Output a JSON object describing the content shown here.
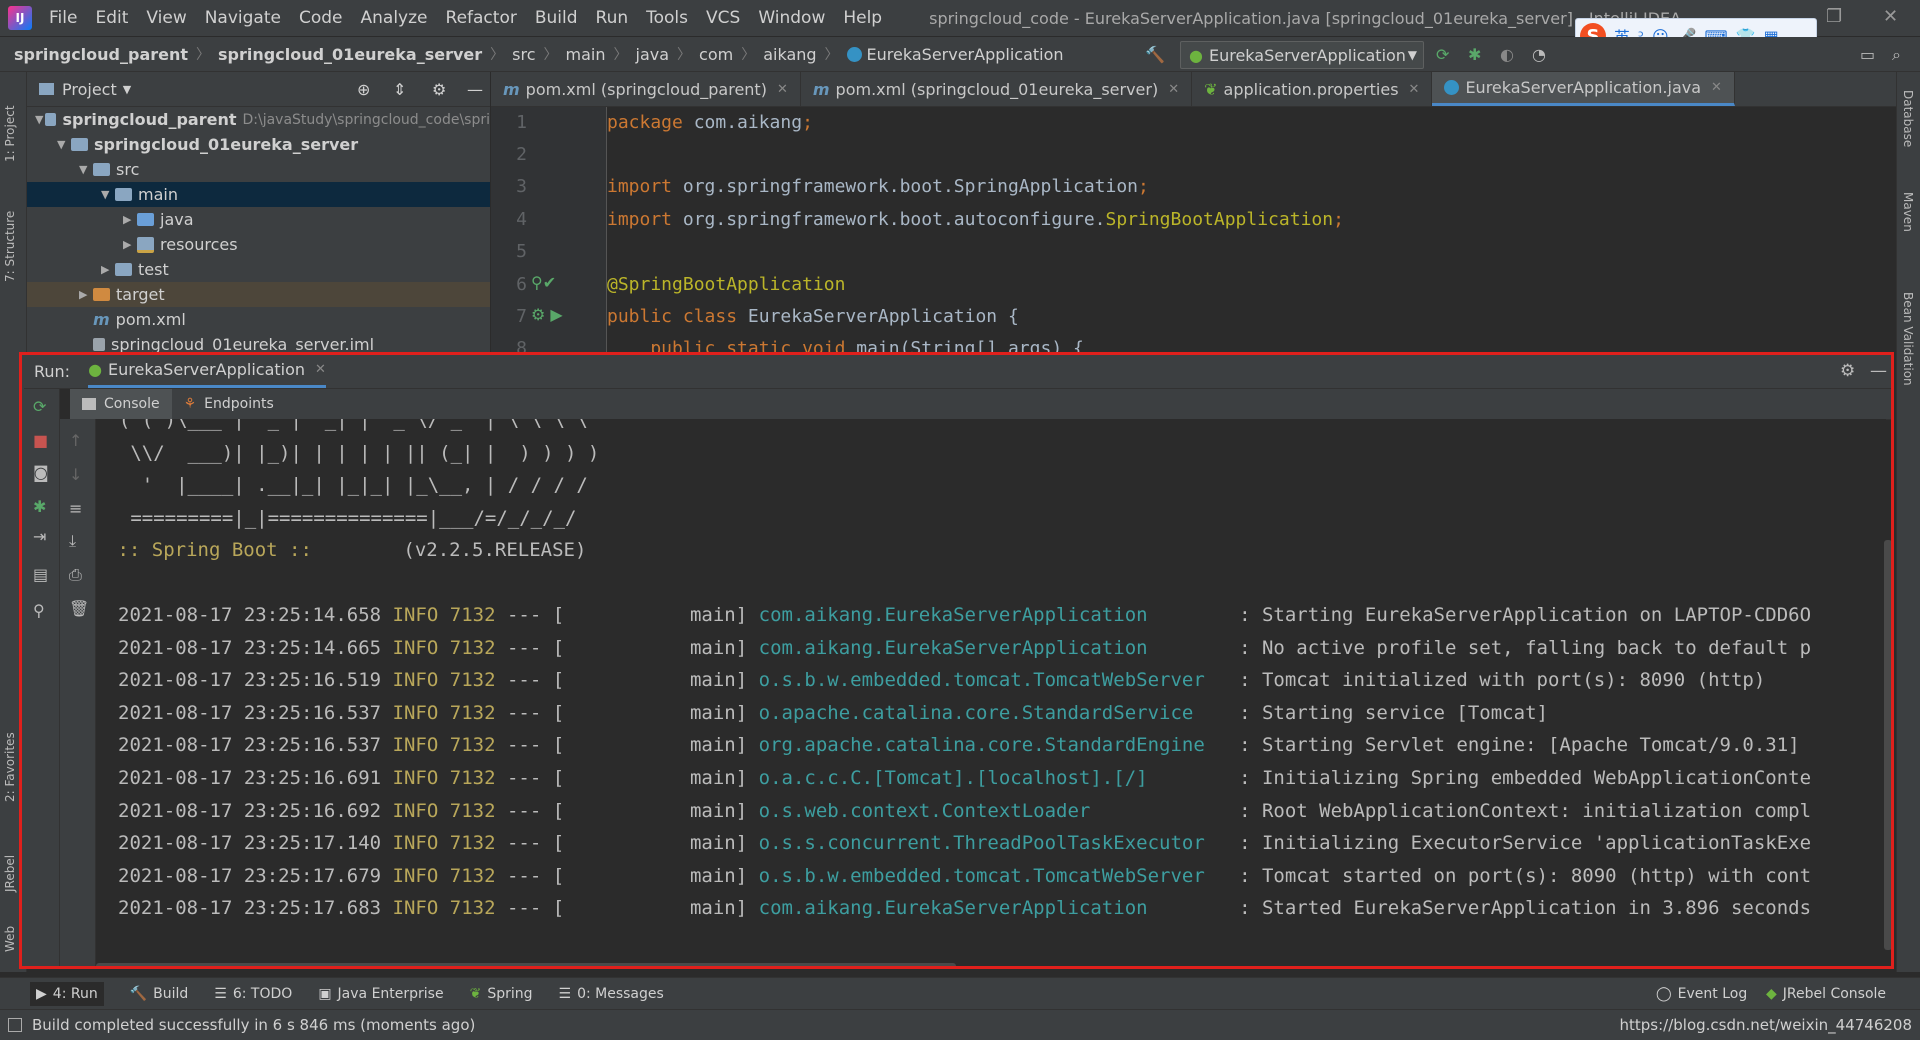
{
  "menubar": {
    "logo": "IJ",
    "items": [
      "File",
      "Edit",
      "View",
      "Navigate",
      "Code",
      "Analyze",
      "Refactor",
      "Build",
      "Run",
      "Tools",
      "VCS",
      "Window",
      "Help"
    ],
    "window_title": "springcloud_code - EurekaServerApplication.java [springcloud_01eureka_server] - IntelliJ IDEA"
  },
  "ime": {
    "logo": "S",
    "mode": "英",
    "punct": "ᵓ"
  },
  "navbar": {
    "breadcrumbs": [
      "springcloud_parent",
      "springcloud_01eureka_server",
      "src",
      "main",
      "java",
      "com",
      "aikang",
      "EurekaServerApplication"
    ],
    "run_config": "EurekaServerApplication"
  },
  "project": {
    "title": "Project",
    "tree": [
      {
        "label": "springcloud_parent",
        "path": "D:\\javaStudy\\springcloud_code\\spri",
        "indent": 0,
        "arrow": "▼",
        "icon": "module"
      },
      {
        "label": "springcloud_01eureka_server",
        "indent": 1,
        "arrow": "▼",
        "icon": "module"
      },
      {
        "label": "src",
        "indent": 2,
        "arrow": "▼",
        "icon": "folder"
      },
      {
        "label": "main",
        "indent": 3,
        "arrow": "▼",
        "icon": "folder",
        "selected": true
      },
      {
        "label": "java",
        "indent": 4,
        "arrow": "▶",
        "icon": "src"
      },
      {
        "label": "resources",
        "indent": 4,
        "arrow": "▶",
        "icon": "res"
      },
      {
        "label": "test",
        "indent": 3,
        "arrow": "▶",
        "icon": "folder"
      },
      {
        "label": "target",
        "indent": 2,
        "arrow": "▶",
        "icon": "excluded"
      },
      {
        "label": "pom.xml",
        "indent": 2,
        "arrow": "",
        "icon": "maven"
      },
      {
        "label": "springcloud_01eureka_server.iml",
        "indent": 2,
        "arrow": "",
        "icon": "iml"
      }
    ]
  },
  "editor_tabs": [
    {
      "label": "pom.xml (springcloud_parent)",
      "icon": "m",
      "active": false
    },
    {
      "label": "pom.xml (springcloud_01eureka_server)",
      "icon": "m",
      "active": false
    },
    {
      "label": "application.properties",
      "icon": "leaf",
      "active": false
    },
    {
      "label": "EurekaServerApplication.java",
      "icon": "class",
      "active": true
    }
  ],
  "code": {
    "line_numbers": [
      "1",
      "2",
      "3",
      "4",
      "5",
      "6",
      "7",
      "8"
    ],
    "lines": [
      [
        {
          "t": "package ",
          "c": "kw"
        },
        {
          "t": "com.aikang",
          "c": ""
        },
        {
          "t": ";",
          "c": "kw"
        }
      ],
      [],
      [
        {
          "t": "import ",
          "c": "kw"
        },
        {
          "t": "org.springframework.boot.SpringApplication",
          "c": ""
        },
        {
          "t": ";",
          "c": "kw"
        }
      ],
      [
        {
          "t": "import ",
          "c": "kw"
        },
        {
          "t": "org.springframework.boot.autoconfigure.",
          "c": ""
        },
        {
          "t": "SpringBootApplication",
          "c": "an"
        },
        {
          "t": ";",
          "c": "kw"
        }
      ],
      [],
      [
        {
          "t": "@SpringBootApplication",
          "c": "an"
        }
      ],
      [
        {
          "t": "public class ",
          "c": "kw"
        },
        {
          "t": "EurekaServerApplication {",
          "c": ""
        }
      ],
      [
        {
          "t": "    public static void ",
          "c": "kw"
        },
        {
          "t": "main(String[] args) {",
          "c": ""
        }
      ]
    ]
  },
  "run": {
    "label": "Run:",
    "tab": "EurekaServerApplication",
    "subtabs": [
      "Console",
      "Endpoints"
    ],
    "banner": [
      "  ( ( )\\___ | '_ | '_| | '_ \\/ _` | \\ \\ \\ \\",
      "   \\\\/  ___)| |_)| | | | | || (_| |  ) ) ) )",
      "    '  |____| .__|_| |_|_| |_\\__, | / / / /",
      "   =========|_|==============|___/=/_/_/_/"
    ],
    "spring_boot_label": " :: Spring Boot :: ",
    "spring_boot_version": "       (v2.2.5.RELEASE)",
    "log": [
      {
        "ts": "2021-08-17 23:25:14.658",
        "level": "INFO",
        "pid": "7132",
        "thread": "main",
        "logger": "com.aikang.EurekaServerApplication",
        "msg": "Starting EurekaServerApplication on LAPTOP-CDD6O"
      },
      {
        "ts": "2021-08-17 23:25:14.665",
        "level": "INFO",
        "pid": "7132",
        "thread": "main",
        "logger": "com.aikang.EurekaServerApplication",
        "msg": "No active profile set, falling back to default p"
      },
      {
        "ts": "2021-08-17 23:25:16.519",
        "level": "INFO",
        "pid": "7132",
        "thread": "main",
        "logger": "o.s.b.w.embedded.tomcat.TomcatWebServer",
        "msg": "Tomcat initialized with port(s): 8090 (http)"
      },
      {
        "ts": "2021-08-17 23:25:16.537",
        "level": "INFO",
        "pid": "7132",
        "thread": "main",
        "logger": "o.apache.catalina.core.StandardService",
        "msg": "Starting service [Tomcat]"
      },
      {
        "ts": "2021-08-17 23:25:16.537",
        "level": "INFO",
        "pid": "7132",
        "thread": "main",
        "logger": "org.apache.catalina.core.StandardEngine",
        "msg": "Starting Servlet engine: [Apache Tomcat/9.0.31]"
      },
      {
        "ts": "2021-08-17 23:25:16.691",
        "level": "INFO",
        "pid": "7132",
        "thread": "main",
        "logger": "o.a.c.c.C.[Tomcat].[localhost].[/]",
        "msg": "Initializing Spring embedded WebApplicationConte"
      },
      {
        "ts": "2021-08-17 23:25:16.692",
        "level": "INFO",
        "pid": "7132",
        "thread": "main",
        "logger": "o.s.web.context.ContextLoader",
        "msg": "Root WebApplicationContext: initialization compl"
      },
      {
        "ts": "2021-08-17 23:25:17.140",
        "level": "INFO",
        "pid": "7132",
        "thread": "main",
        "logger": "o.s.s.concurrent.ThreadPoolTaskExecutor",
        "msg": "Initializing ExecutorService 'applicationTaskExe"
      },
      {
        "ts": "2021-08-17 23:25:17.679",
        "level": "INFO",
        "pid": "7132",
        "thread": "main",
        "logger": "o.s.b.w.embedded.tomcat.TomcatWebServer",
        "msg": "Tomcat started on port(s): 8090 (http) with cont"
      },
      {
        "ts": "2021-08-17 23:25:17.683",
        "level": "INFO",
        "pid": "7132",
        "thread": "main",
        "logger": "com.aikang.EurekaServerApplication",
        "msg": "Started EurekaServerApplication in 3.896 seconds"
      }
    ]
  },
  "left_strip": {
    "project": "1: Project",
    "structure": "7: Structure",
    "favorites": "2: Favorites",
    "jrebel": "JRebel",
    "web": "Web"
  },
  "right_strip": {
    "database": "Database",
    "maven": "Maven",
    "bean": "Bean Validation"
  },
  "tool_windows": [
    "4: Run",
    "Build",
    "6: TODO",
    "Java Enterprise",
    "Spring",
    "0: Messages"
  ],
  "tool_windows_right": [
    "Event Log",
    "JRebel Console"
  ],
  "status": {
    "message": "Build completed successfully in 6 s 846 ms (moments ago)",
    "right": "https://blog.csdn.net/weixin_44746208"
  },
  "colors": {
    "accent": "#4a88c7",
    "highlight_box": "#e0201c",
    "keyword": "#cc7832",
    "annotation": "#bbb529",
    "logger": "#3d9ea0"
  }
}
